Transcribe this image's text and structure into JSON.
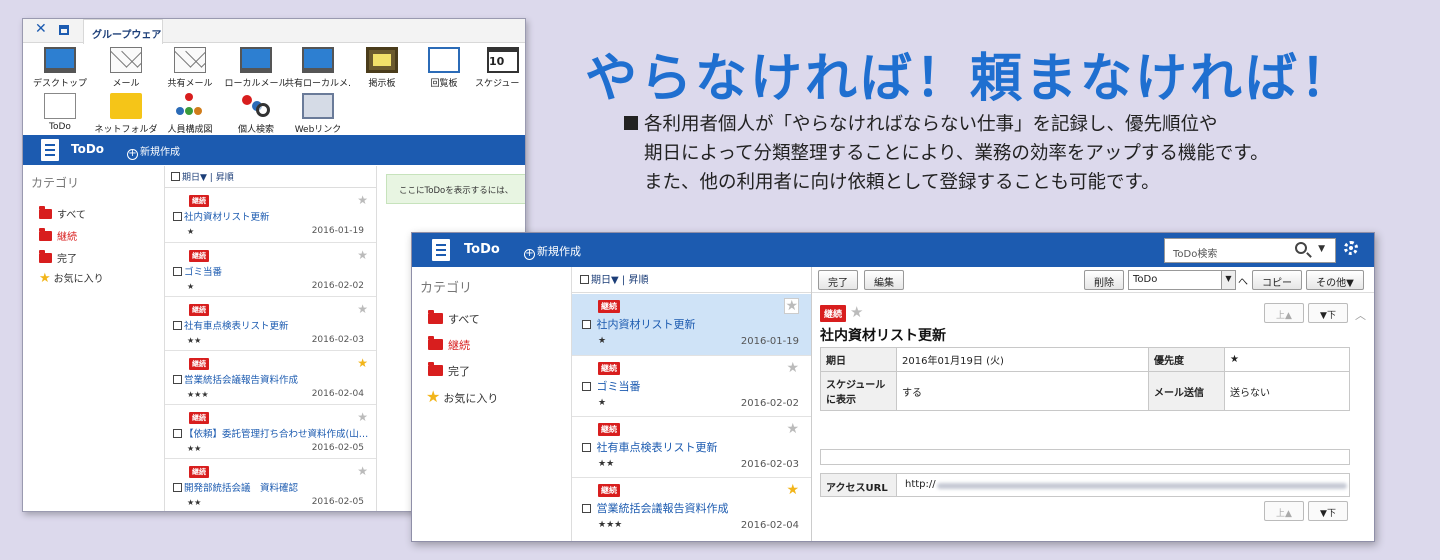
{
  "headline": "やらなければ！頼まなければ！",
  "description": {
    "line1": "各利用者個人が「やらなければならない仕事」を記録し、優先順位や",
    "line2": "期日によって分類整理することにより、業務の効率をアップする機能です。",
    "line3": "また、他の利用者に向け依頼として登録することも可能です。"
  },
  "back_window": {
    "tab_label": "グループウェア",
    "apps": [
      {
        "label": "デスクトップ",
        "icon": "monitor-icon"
      },
      {
        "label": "メール",
        "icon": "mail-icon"
      },
      {
        "label": "共有メール",
        "icon": "shared-mail-icon"
      },
      {
        "label": "ローカルメール",
        "icon": "local-mail-icon"
      },
      {
        "label": "共有ローカルメ…",
        "icon": "shared-local-mail-icon"
      },
      {
        "label": "掲示板",
        "icon": "bulletin-board-icon"
      },
      {
        "label": "回覧板",
        "icon": "circular-board-icon"
      },
      {
        "label": "スケジュー",
        "icon": "calendar-icon",
        "day": "10"
      },
      {
        "label": "ToDo",
        "icon": "todo-icon"
      },
      {
        "label": "ネットフォルダ",
        "icon": "folder-icon"
      },
      {
        "label": "人員構成図",
        "icon": "org-chart-icon"
      },
      {
        "label": "個人検索",
        "icon": "people-search-icon"
      },
      {
        "label": "Webリンク",
        "icon": "web-link-icon"
      }
    ],
    "app_title": "ToDo",
    "new_label": "新規作成",
    "category_title": "カテゴリ",
    "categories": [
      {
        "label": "すべて",
        "color": "#333333"
      },
      {
        "label": "継続",
        "color": "#d81e1e"
      },
      {
        "label": "完了",
        "color": "#333333"
      },
      {
        "label": "お気に入り",
        "color": "#333333"
      }
    ],
    "sort_label": "期日▼",
    "sort_sep": "|",
    "sort_order": "昇順",
    "items": [
      {
        "badge": "継続",
        "title": "社内資材リスト更新",
        "stars": "★",
        "date": "2016-01-19",
        "favorite": false
      },
      {
        "badge": "継続",
        "title": "ゴミ当番",
        "stars": "★",
        "date": "2016-02-02",
        "favorite": false
      },
      {
        "badge": "継続",
        "title": "社有車点検表リスト更新",
        "stars": "★★",
        "date": "2016-02-03",
        "favorite": false
      },
      {
        "badge": "継続",
        "title": "営業統括会議報告資料作成",
        "stars": "★★★",
        "date": "2016-02-04",
        "favorite": true
      },
      {
        "badge": "継続",
        "title": "【依頼】委託管理打ち合わせ資料作成(山…",
        "stars": "★★",
        "date": "2016-02-05",
        "favorite": false
      },
      {
        "badge": "継続",
        "title": "開発部統括会議　資料確認",
        "stars": "★★",
        "date": "2016-02-05",
        "favorite": false
      }
    ],
    "notice": "ここにToDoを表示するには、"
  },
  "front_window": {
    "app_title": "ToDo",
    "new_label": "新規作成",
    "search_placeholder": "ToDo検索",
    "category_title": "カテゴリ",
    "categories": [
      {
        "label": "すべて"
      },
      {
        "label": "継続"
      },
      {
        "label": "完了"
      },
      {
        "label": "お気に入り"
      }
    ],
    "sort_label": "期日▼",
    "sort_sep": "|",
    "sort_order": "昇順",
    "items": [
      {
        "badge": "継続",
        "title": "社内資材リスト更新",
        "stars": "★",
        "date": "2016-01-19",
        "favorite": false
      },
      {
        "badge": "継続",
        "title": "ゴミ当番",
        "stars": "★",
        "date": "2016-02-02",
        "favorite": false
      },
      {
        "badge": "継続",
        "title": "社有車点検表リスト更新",
        "stars": "★★",
        "date": "2016-02-03",
        "favorite": false
      },
      {
        "badge": "継続",
        "title": "営業統括会議報告資料作成",
        "stars": "★★★",
        "date": "2016-02-04",
        "favorite": true
      }
    ],
    "toolbar": {
      "complete": "完了",
      "edit": "編集",
      "delete": "削除",
      "move_select": "ToDo",
      "move_suffix": "へ",
      "copy": "コピー",
      "other": "その他▼"
    },
    "nav": {
      "up": "上▲",
      "down": "▼下"
    },
    "detail": {
      "badge": "継続",
      "title": "社内資材リスト更新",
      "due_label": "期日",
      "due_value": "2016年01月19日 (火)",
      "priority_label": "優先度",
      "priority_value": "★",
      "show_sched_label": "スケジュールに表示",
      "show_sched_value": "する",
      "mail_label": "メール送信",
      "mail_value": "送らない",
      "url_label": "アクセスURL",
      "url_value": "http://"
    }
  },
  "colors": {
    "accent_blue": "#1c5bb0",
    "badge_red": "#d81e1e",
    "headline_blue": "#1f6fd0",
    "favorite_yellow": "#f2b51a",
    "background": "#dcd9ec"
  }
}
